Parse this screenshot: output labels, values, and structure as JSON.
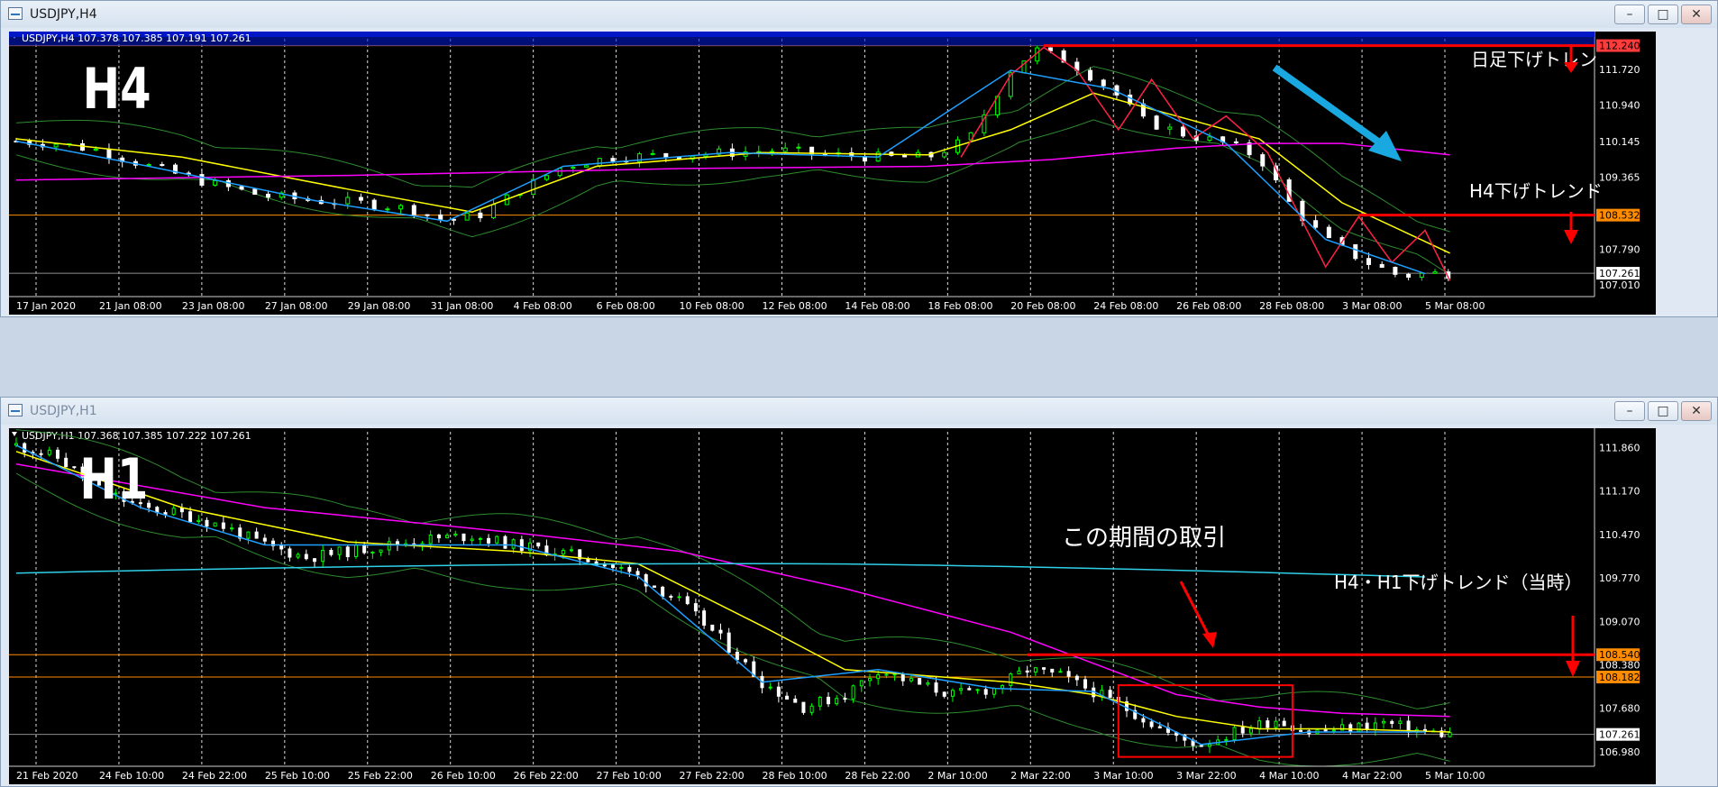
{
  "colors": {
    "background": "#000000",
    "bull_candle": "#00ff00",
    "bear_candle": "#ffffff",
    "ma_fast": "#ffff00",
    "ma_slow": "#ff00ff",
    "bollinger": "#2e8b2e",
    "zigzag": "#ff2244",
    "trendline": "#1e9fff",
    "resistance_line": "#ff0000",
    "level_line": "#ff8c00",
    "annotation_arrow": "#ff0000",
    "blue_arrow": "#1aa8e0"
  },
  "window_h4": {
    "title": "USDJPY,H4",
    "controls": {
      "minimize": "–",
      "restore": "□",
      "close": "✕"
    },
    "chart_info": "USDJPY,H4  107.378 107.385 107.191 107.261",
    "timeframe_label": "H4",
    "price_labels": [
      "112.240",
      "111.720",
      "110.940",
      "110.145",
      "109.365",
      "108.532",
      "107.790",
      "107.261",
      "107.010"
    ],
    "highlight_price_top": "112.240",
    "highlight_price_mid": "108.532",
    "current_price": "107.261",
    "time_labels": [
      "17 Jan 2020",
      "21 Jan 08:00",
      "23 Jan 08:00",
      "27 Jan 08:00",
      "29 Jan 08:00",
      "31 Jan 08:00",
      "4 Feb 08:00",
      "6 Feb 08:00",
      "10 Feb 08:00",
      "12 Feb 08:00",
      "14 Feb 08:00",
      "18 Feb 08:00",
      "20 Feb 08:00",
      "24 Feb 08:00",
      "26 Feb 08:00",
      "28 Feb 08:00",
      "3 Mar 08:00",
      "5 Mar 08:00"
    ],
    "annotations": {
      "daily_trend": "日足下げトレン",
      "h4_trend": "H4下げトレンド"
    }
  },
  "window_h1": {
    "title": "USDJPY,H1",
    "controls": {
      "minimize": "–",
      "restore": "□",
      "close": "✕"
    },
    "chart_info": "USDJPY,H1  107.368 107.385 107.222 107.261",
    "timeframe_label": "H1",
    "price_labels": [
      "111.860",
      "111.170",
      "110.470",
      "109.770",
      "109.070",
      "108.540",
      "108.380",
      "108.182",
      "107.680",
      "107.261",
      "106.980"
    ],
    "highlight_price_top": "108.540",
    "highlight_price_mid": "108.182",
    "current_price": "107.261",
    "time_labels": [
      "21 Feb 2020",
      "24 Feb 10:00",
      "24 Feb 22:00",
      "25 Feb 10:00",
      "25 Feb 22:00",
      "26 Feb 10:00",
      "26 Feb 22:00",
      "27 Feb 10:00",
      "27 Feb 22:00",
      "28 Feb 10:00",
      "28 Feb 22:00",
      "2 Mar 10:00",
      "2 Mar 22:00",
      "3 Mar 10:00",
      "3 Mar 22:00",
      "4 Mar 10:00",
      "4 Mar 22:00",
      "5 Mar 10:00"
    ],
    "annotations": {
      "trade_period": "この期間の取引",
      "h4_h1_trend": "H4・H1下げトレンド（当時）"
    }
  },
  "chart_data": [
    {
      "type": "candlestick",
      "symbol": "USDJPY",
      "timeframe": "H4",
      "ohlc_header": {
        "open": 107.378,
        "high": 107.385,
        "low": 107.191,
        "close": 107.261
      },
      "ylim": [
        106.75,
        112.35
      ],
      "x_ticks": [
        "17 Jan 2020",
        "21 Jan 08:00",
        "23 Jan 08:00",
        "27 Jan 08:00",
        "29 Jan 08:00",
        "31 Jan 08:00",
        "4 Feb 08:00",
        "6 Feb 08:00",
        "10 Feb 08:00",
        "12 Feb 08:00",
        "14 Feb 08:00",
        "18 Feb 08:00",
        "20 Feb 08:00",
        "24 Feb 08:00",
        "26 Feb 08:00",
        "28 Feb 08:00",
        "3 Mar 08:00",
        "5 Mar 08:00"
      ],
      "y_ticks": [
        112.24,
        111.72,
        110.94,
        110.145,
        109.365,
        108.532,
        107.79,
        107.261,
        107.01
      ],
      "horizontal_levels": [
        112.24,
        108.532,
        107.261
      ],
      "price_path": [
        [
          0,
          110.15
        ],
        [
          0.5,
          110.1
        ],
        [
          1,
          109.95
        ],
        [
          1.6,
          109.6
        ],
        [
          2.4,
          109.2
        ],
        [
          3,
          108.95
        ],
        [
          3.6,
          108.85
        ],
        [
          4.2,
          108.8
        ],
        [
          4.8,
          108.65
        ],
        [
          5.2,
          108.4
        ],
        [
          5.6,
          108.55
        ],
        [
          6.1,
          109.1
        ],
        [
          6.6,
          109.6
        ],
        [
          7.2,
          109.8
        ],
        [
          8,
          109.85
        ],
        [
          8.6,
          109.9
        ],
        [
          9.2,
          109.95
        ],
        [
          9.8,
          109.85
        ],
        [
          10.4,
          109.8
        ],
        [
          11,
          109.8
        ],
        [
          11.5,
          110.2
        ],
        [
          12,
          111.7
        ],
        [
          12.3,
          112.15
        ],
        [
          12.7,
          111.9
        ],
        [
          13.2,
          111.3
        ],
        [
          13.6,
          110.6
        ],
        [
          14.1,
          110.3
        ],
        [
          14.6,
          110.1
        ],
        [
          15,
          109.8
        ],
        [
          15.4,
          108.7
        ],
        [
          15.8,
          108.0
        ],
        [
          16.3,
          107.5
        ],
        [
          16.7,
          107.2
        ],
        [
          17,
          107.25
        ],
        [
          17.3,
          107.26
        ]
      ],
      "ma_fast": [
        [
          0,
          110.2
        ],
        [
          2,
          109.8
        ],
        [
          4,
          109.1
        ],
        [
          5.5,
          108.6
        ],
        [
          7,
          109.6
        ],
        [
          9,
          109.9
        ],
        [
          11,
          109.85
        ],
        [
          12,
          110.4
        ],
        [
          13,
          111.2
        ],
        [
          14,
          110.7
        ],
        [
          15,
          110.2
        ],
        [
          16,
          108.8
        ],
        [
          17.3,
          107.7
        ]
      ],
      "ma_slow": [
        [
          0,
          109.3
        ],
        [
          4,
          109.4
        ],
        [
          8,
          109.55
        ],
        [
          11,
          109.6
        ],
        [
          12.5,
          109.75
        ],
        [
          14,
          110.0
        ],
        [
          15,
          110.1
        ],
        [
          16,
          110.1
        ],
        [
          17.3,
          109.85
        ]
      ],
      "zigzag": [
        [
          11.4,
          109.8
        ],
        [
          12,
          111.6
        ],
        [
          12.4,
          112.2
        ],
        [
          12.8,
          111.7
        ],
        [
          13.3,
          110.4
        ],
        [
          13.7,
          111.5
        ],
        [
          14.2,
          110.2
        ],
        [
          14.6,
          110.7
        ],
        [
          15.1,
          109.9
        ],
        [
          15.8,
          107.4
        ],
        [
          16.2,
          108.5
        ],
        [
          16.6,
          107.5
        ],
        [
          17,
          108.2
        ],
        [
          17.3,
          107.1
        ]
      ]
    },
    {
      "type": "candlestick",
      "symbol": "USDJPY",
      "timeframe": "H1",
      "ohlc_header": {
        "open": 107.368,
        "high": 107.385,
        "low": 107.222,
        "close": 107.261
      },
      "ylim": [
        106.75,
        112.0
      ],
      "x_ticks": [
        "21 Feb 2020",
        "24 Feb 10:00",
        "24 Feb 22:00",
        "25 Feb 10:00",
        "25 Feb 22:00",
        "26 Feb 10:00",
        "26 Feb 22:00",
        "27 Feb 10:00",
        "27 Feb 22:00",
        "28 Feb 10:00",
        "28 Feb 22:00",
        "2 Mar 10:00",
        "2 Mar 22:00",
        "3 Mar 10:00",
        "3 Mar 22:00",
        "4 Mar 10:00",
        "4 Mar 22:00",
        "5 Mar 10:00"
      ],
      "y_ticks": [
        111.86,
        111.17,
        110.47,
        109.77,
        109.07,
        108.54,
        108.38,
        108.182,
        107.68,
        107.261,
        106.98
      ],
      "horizontal_levels": [
        108.54,
        108.182,
        107.261
      ],
      "price_path": [
        [
          0,
          111.9
        ],
        [
          0.5,
          111.7
        ],
        [
          1,
          111.2
        ],
        [
          1.5,
          110.9
        ],
        [
          2,
          110.8
        ],
        [
          2.5,
          110.6
        ],
        [
          3,
          110.3
        ],
        [
          3.5,
          110.1
        ],
        [
          4,
          110.2
        ],
        [
          4.5,
          110.3
        ],
        [
          5,
          110.4
        ],
        [
          5.5,
          110.45
        ],
        [
          6,
          110.3
        ],
        [
          6.5,
          110.2
        ],
        [
          7,
          110.05
        ],
        [
          7.5,
          109.8
        ],
        [
          8,
          109.4
        ],
        [
          8.5,
          108.8
        ],
        [
          9,
          108.1
        ],
        [
          9.5,
          107.7
        ],
        [
          10,
          107.9
        ],
        [
          10.4,
          108.3
        ],
        [
          10.8,
          108.1
        ],
        [
          11.3,
          107.9
        ],
        [
          11.8,
          108.0
        ],
        [
          12.2,
          108.3
        ],
        [
          12.6,
          108.2
        ],
        [
          13,
          107.95
        ],
        [
          13.5,
          107.6
        ],
        [
          14,
          107.2
        ],
        [
          14.3,
          107.1
        ],
        [
          14.7,
          107.3
        ],
        [
          15.2,
          107.5
        ],
        [
          15.6,
          107.3
        ],
        [
          16,
          107.35
        ],
        [
          16.5,
          107.45
        ],
        [
          17,
          107.3
        ],
        [
          17.3,
          107.26
        ]
      ],
      "ma_fast": [
        [
          0,
          111.8
        ],
        [
          2,
          110.9
        ],
        [
          4,
          110.35
        ],
        [
          6,
          110.2
        ],
        [
          7.5,
          110.0
        ],
        [
          9,
          109.0
        ],
        [
          10,
          108.3
        ],
        [
          11,
          108.2
        ],
        [
          12,
          108.1
        ],
        [
          13,
          107.9
        ],
        [
          14,
          107.55
        ],
        [
          15,
          107.35
        ],
        [
          16,
          107.35
        ],
        [
          17.3,
          107.3
        ]
      ],
      "ma_slow": [
        [
          0,
          111.6
        ],
        [
          3,
          110.9
        ],
        [
          6,
          110.5
        ],
        [
          8,
          110.2
        ],
        [
          10,
          109.6
        ],
        [
          12,
          108.9
        ],
        [
          13,
          108.4
        ],
        [
          14,
          107.9
        ],
        [
          15,
          107.7
        ],
        [
          16,
          107.6
        ],
        [
          17.3,
          107.55
        ]
      ],
      "trade_box": {
        "x_from": 13.3,
        "x_to": 15.4,
        "y_from": 106.9,
        "y_to": 108.05
      }
    }
  ]
}
